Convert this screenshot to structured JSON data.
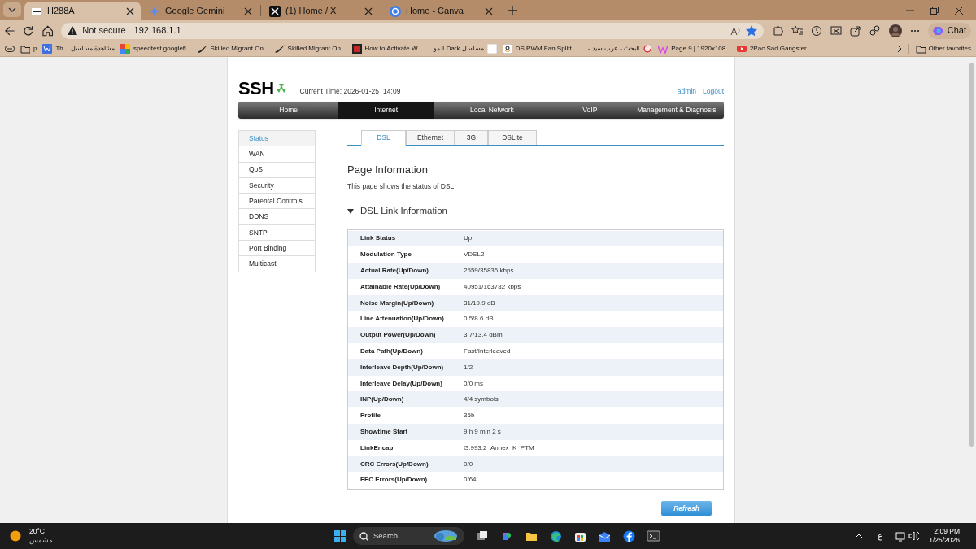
{
  "browser": {
    "tabs": [
      {
        "title": "H288A",
        "selected": true
      },
      {
        "title": "Google Gemini",
        "selected": false
      },
      {
        "title": "(1) Home / X",
        "selected": false
      },
      {
        "title": "Home - Canva",
        "selected": false
      }
    ],
    "address": {
      "security": "Not secure",
      "url": "192.168.1.1"
    },
    "bookmarks": [
      "p",
      "Th... مشاهدة مسلسل",
      "speedtest.googlefi...",
      "Skilled Migrant On...",
      "Skilled Migrant On...",
      "How to Activate W...",
      "مسلسل Dark المو...",
      "DS PWM Fan Splitt...",
      "البحث - عرب سيد -...",
      "Page 9 | 1920x108...",
      "2Pac Sad Gangster..."
    ],
    "other_favorites": "Other favorites",
    "chat": "Chat"
  },
  "router": {
    "logo": "SSH",
    "current_time": "Current Time: 2026-01-25T14:09",
    "user": "admin",
    "logout": "Logout",
    "nav": [
      {
        "label": "Home",
        "selected": false
      },
      {
        "label": "Internet",
        "selected": true
      },
      {
        "label": "Local Network",
        "selected": false
      },
      {
        "label": "VoIP",
        "selected": false
      },
      {
        "label": "Management & Diagnosis",
        "selected": false
      }
    ],
    "sidebar": [
      {
        "label": "Status",
        "selected": true
      },
      {
        "label": "WAN",
        "selected": false
      },
      {
        "label": "QoS",
        "selected": false
      },
      {
        "label": "Security",
        "selected": false
      },
      {
        "label": "Parental Controls",
        "selected": false
      },
      {
        "label": "DDNS",
        "selected": false
      },
      {
        "label": "SNTP",
        "selected": false
      },
      {
        "label": "Port Binding",
        "selected": false
      },
      {
        "label": "Multicast",
        "selected": false
      }
    ],
    "subtabs": [
      {
        "label": "DSL",
        "selected": true
      },
      {
        "label": "Ethernet",
        "selected": false
      },
      {
        "label": "3G",
        "selected": false
      },
      {
        "label": "DSLite",
        "selected": false
      }
    ],
    "heading": "Page Information",
    "description": "This page shows the status of DSL.",
    "section": {
      "title": "DSL Link Information",
      "expanded": true
    },
    "rows": [
      {
        "label": "Link Status",
        "value": "Up"
      },
      {
        "label": "Modulation Type",
        "value": "VDSL2"
      },
      {
        "label": "Actual Rate(Up/Down)",
        "value": "2559/35836 kbps"
      },
      {
        "label": "Attainable Rate(Up/Down)",
        "value": "40951/163782 kbps"
      },
      {
        "label": "Noise Margin(Up/Down)",
        "value": "31/19.9 dB"
      },
      {
        "label": "Line Attenuation(Up/Down)",
        "value": "0.5/8.6 dB"
      },
      {
        "label": "Output Power(Up/Down)",
        "value": "3.7/13.4 dBm"
      },
      {
        "label": "Data Path(Up/Down)",
        "value": "Fast/Interleaved"
      },
      {
        "label": "Interleave Depth(Up/Down)",
        "value": "1/2"
      },
      {
        "label": "Interleave Delay(Up/Down)",
        "value": "0/0 ms"
      },
      {
        "label": "INP(Up/Down)",
        "value": "4/4 symbols"
      },
      {
        "label": "Profile",
        "value": "35b"
      },
      {
        "label": "Showtime Start",
        "value": "9 h 9 min 2 s"
      },
      {
        "label": "LinkEncap",
        "value": "G.993.2_Annex_K_PTM"
      },
      {
        "label": "CRC Errors(Up/Down)",
        "value": "0/0"
      },
      {
        "label": "FEC Errors(Up/Down)",
        "value": "0/64"
      }
    ],
    "refresh": "Refresh"
  },
  "taskbar": {
    "temperature": "20°C",
    "condition": "مشمس",
    "search": "Search",
    "input_language": "ع",
    "time": "2:09 PM",
    "date": "1/25/2026"
  }
}
